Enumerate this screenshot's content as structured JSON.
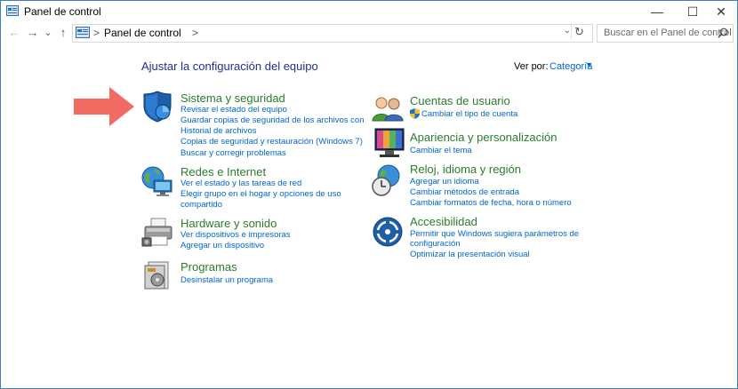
{
  "window": {
    "title": "Panel de control",
    "min_symbol": "—",
    "max_symbol": "☐",
    "close_symbol": "✕"
  },
  "nav": {
    "back": "←",
    "forward": "→",
    "recent": "⌄",
    "up": "↑",
    "breadcrumb_sep": ">",
    "breadcrumb": "Panel de control",
    "breadcrumb_sep2": ">",
    "dropdown": "⌄",
    "refresh": "↻"
  },
  "search": {
    "placeholder": "Buscar en el Panel de control"
  },
  "main": {
    "heading": "Ajustar la configuración del equipo",
    "view_by_label": "Ver por:",
    "view_by_value": "Categoría"
  },
  "categories": {
    "security": {
      "title": "Sistema y seguridad",
      "links": [
        "Revisar el estado del equipo",
        "Guardar copias de seguridad de los archivos con",
        "Historial de archivos",
        "Copias de seguridad y restauración (Windows 7)",
        "Buscar y corregir problemas"
      ]
    },
    "network": {
      "title": "Redes e Internet",
      "links": [
        "Ver el estado y las tareas de red",
        "Elegir grupo en el hogar y opciones de uso",
        "compartido"
      ]
    },
    "hardware": {
      "title": "Hardware y sonido",
      "links": [
        "Ver dispositivos e impresoras",
        "Agregar un dispositivo"
      ]
    },
    "programs": {
      "title": "Programas",
      "links": [
        "Desinstalar un programa"
      ]
    },
    "accounts": {
      "title": "Cuentas de usuario",
      "links": [
        "Cambiar el tipo de cuenta"
      ]
    },
    "appearance": {
      "title": "Apariencia y personalización",
      "links": [
        "Cambiar el tema"
      ]
    },
    "clock": {
      "title": "Reloj, idioma y región",
      "links": [
        "Agregar un idioma",
        "Cambiar métodos de entrada",
        "Cambiar formatos de fecha, hora o número"
      ]
    },
    "access": {
      "title": "Accesibilidad",
      "links": [
        "Permitir que Windows sugiera parámetros de",
        "configuración",
        "Optimizar la presentación visual"
      ]
    }
  },
  "colors": {
    "heading": "#1e3287",
    "category_title": "#2b7c2b",
    "link": "#0066cc",
    "arrow": "#f26b62"
  }
}
